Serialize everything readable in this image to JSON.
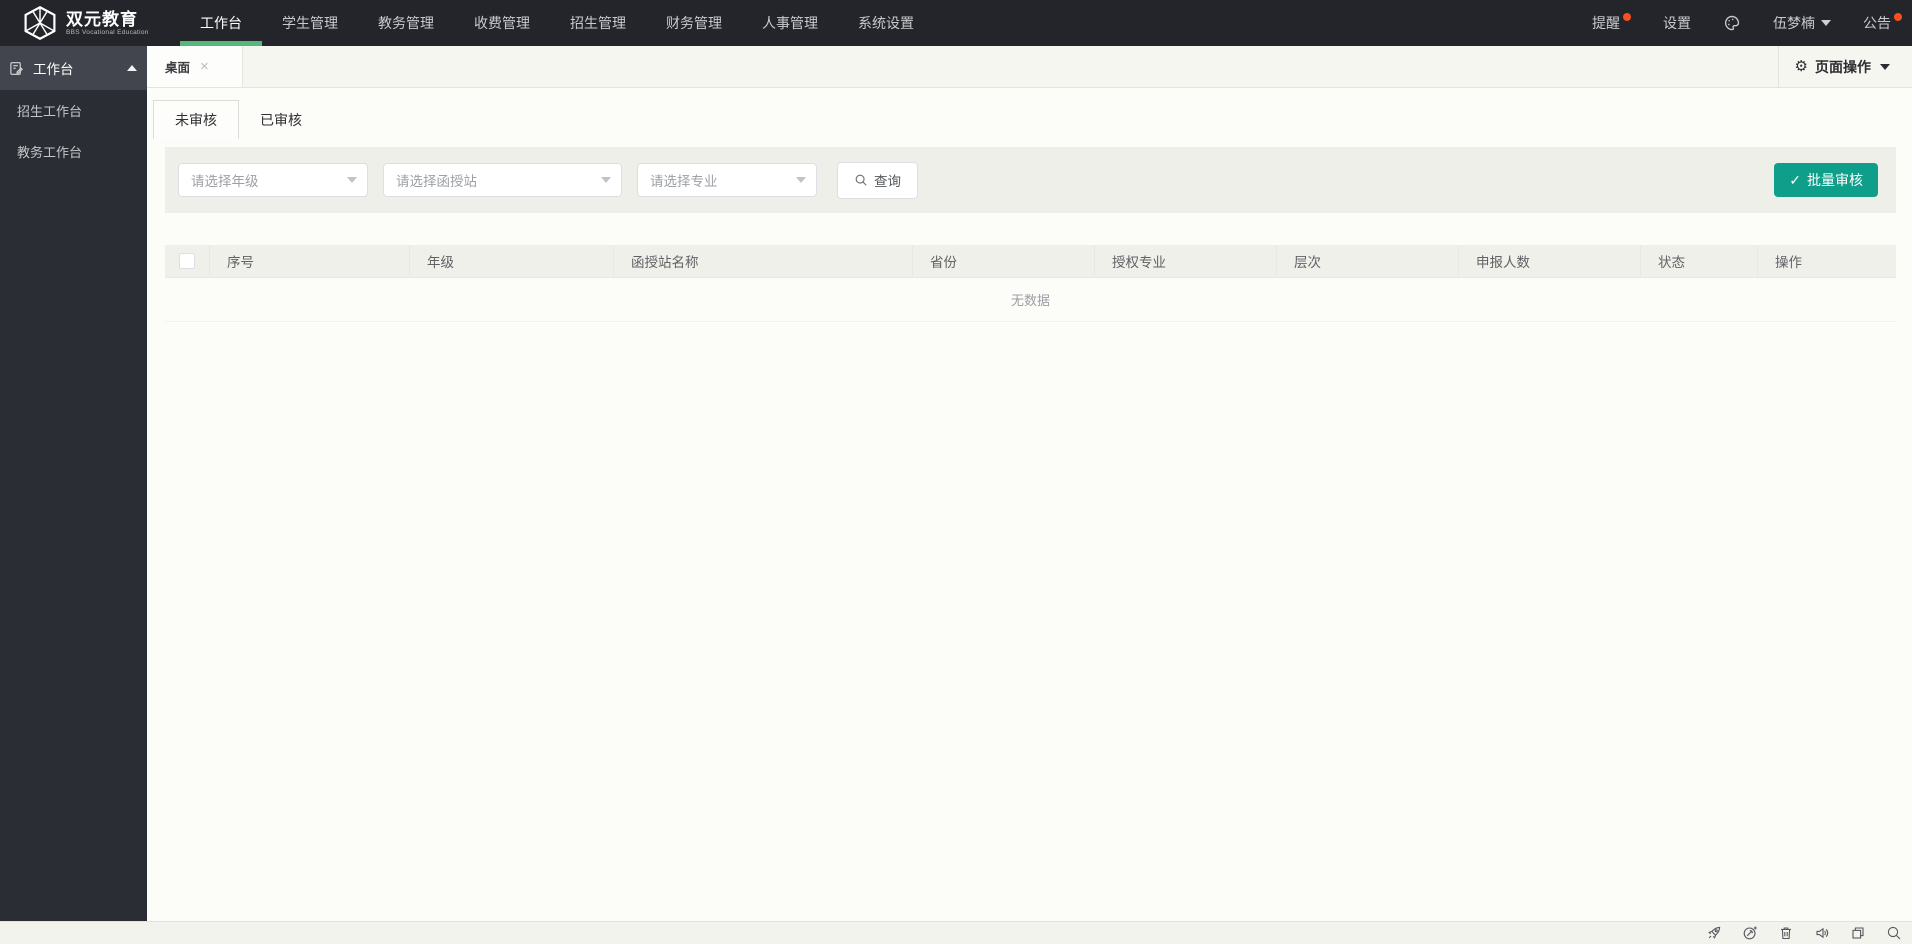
{
  "navbar": {
    "logo": {
      "title": "双元教育",
      "subtitle": "BBS Vocational Education",
      "icon": "hexagon-cube-logo"
    },
    "menu": [
      {
        "label": "工作台",
        "active": true
      },
      {
        "label": "学生管理"
      },
      {
        "label": "教务管理"
      },
      {
        "label": "收费管理"
      },
      {
        "label": "招生管理"
      },
      {
        "label": "财务管理"
      },
      {
        "label": "人事管理"
      },
      {
        "label": "系统设置"
      }
    ],
    "right": {
      "reminder_label": "提醒",
      "reminder_has_badge": true,
      "settings_label": "设置",
      "theme_icon": "palette-icon",
      "username": "伍梦楠",
      "announcement_label": "公告",
      "announcement_has_badge": true
    }
  },
  "tabstrip": {
    "tabs": [
      {
        "label": "桌面",
        "active": true,
        "closable": true
      }
    ],
    "page_actions_label": "页面操作",
    "page_actions_icon": "gear-icon"
  },
  "sidebar": {
    "group": {
      "label": "工作台",
      "expanded": true,
      "icon": "workbench-doc-icon"
    },
    "items": [
      {
        "label": "招生工作台"
      },
      {
        "label": "教务工作台"
      }
    ]
  },
  "main": {
    "review_tabs": [
      {
        "label": "未审核",
        "active": true
      },
      {
        "label": "已审核",
        "active": false
      }
    ],
    "filters": {
      "selects": [
        {
          "placeholder": "请选择年级"
        },
        {
          "placeholder": "请选择函授站"
        },
        {
          "placeholder": "请选择专业"
        }
      ],
      "query_label": "查询",
      "query_icon": "search-icon",
      "batch_review_label": "批量审核",
      "batch_review_icon": "check-icon"
    },
    "table": {
      "columns": [
        "序号",
        "年级",
        "函授站名称",
        "省份",
        "授权专业",
        "层次",
        "申报人数",
        "状态",
        "操作"
      ],
      "rows": [],
      "empty_text": "无数据"
    }
  },
  "bottombar": {
    "icons": [
      "rocket-icon",
      "speed-test-icon",
      "trash-icon",
      "speaker-icon",
      "windows-icon",
      "search-icon"
    ]
  },
  "glyphs": {
    "check": "✓",
    "gear": "⚙",
    "close": "×"
  },
  "colors": {
    "navbar_bg": "#23252b",
    "sidebar_bg": "#2b2d34",
    "accent_green": "#55b87b",
    "button_teal": "#0e9e8a",
    "notification_red": "#f94f1e"
  }
}
